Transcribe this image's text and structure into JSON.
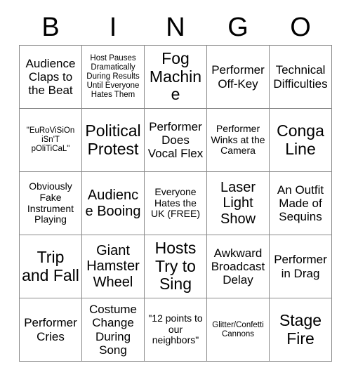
{
  "card": {
    "header_letters": [
      "B",
      "I",
      "N",
      "G",
      "O"
    ],
    "columns": 5,
    "rows": 5,
    "grid": [
      [
        {
          "text": "Audience Claps to the Beat",
          "size": "fs-md"
        },
        {
          "text": "Host Pauses Dramatically During Results Until Everyone Hates Them",
          "size": "fs-xs"
        },
        {
          "text": "Fog Machine",
          "size": "fs-xl"
        },
        {
          "text": "Performer Off-Key",
          "size": "fs-md"
        },
        {
          "text": "Technical Difficulties",
          "size": "fs-md"
        }
      ],
      [
        {
          "text": "\"EuRoViSiOn iSn'T pOliTiCaL\"",
          "size": "fs-xs"
        },
        {
          "text": "Political Protest",
          "size": "fs-xl"
        },
        {
          "text": "Performer Does Vocal Flex",
          "size": "fs-md"
        },
        {
          "text": "Performer Winks at the Camera",
          "size": "fs-sm"
        },
        {
          "text": "Conga Line",
          "size": "fs-xl"
        }
      ],
      [
        {
          "text": "Obviously Fake Instrument Playing",
          "size": "fs-sm"
        },
        {
          "text": "Audience Booing",
          "size": "fs-lg"
        },
        {
          "text": "Everyone Hates the UK (FREE)",
          "size": "fs-sm"
        },
        {
          "text": "Laser Light Show",
          "size": "fs-lg"
        },
        {
          "text": "An Outfit Made of Sequins",
          "size": "fs-md"
        }
      ],
      [
        {
          "text": "Trip and Fall",
          "size": "fs-xl"
        },
        {
          "text": "Giant Hamster Wheel",
          "size": "fs-lg"
        },
        {
          "text": "Hosts Try to Sing",
          "size": "fs-xl"
        },
        {
          "text": "Awkward Broadcast Delay",
          "size": "fs-md"
        },
        {
          "text": "Performer in Drag",
          "size": "fs-md"
        }
      ],
      [
        {
          "text": "Performer Cries",
          "size": "fs-md"
        },
        {
          "text": "Costume Change During Song",
          "size": "fs-md"
        },
        {
          "text": "\"12 points to our neighbors\"",
          "size": "fs-sm"
        },
        {
          "text": "Glitter/Confetti Cannons",
          "size": "fs-xs"
        },
        {
          "text": "Stage Fire",
          "size": "fs-xl"
        }
      ]
    ]
  }
}
